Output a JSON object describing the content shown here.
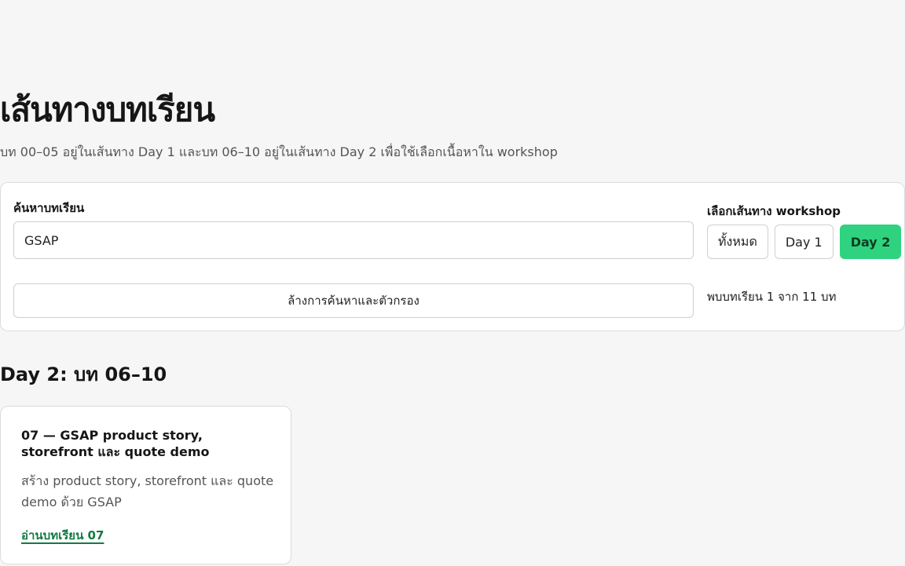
{
  "header": {
    "title": "เส้นทางบทเรียน",
    "subtitle": "บท 00–05 อยู่ในเส้นทาง Day 1 และบท 06–10 อยู่ในเส้นทาง Day 2 เพื่อใช้เลือกเนื้อหาใน workshop"
  },
  "filters": {
    "search_label": "ค้นหาบทเรียน",
    "search_value": "GSAP",
    "clear_label": "ล้างการค้นหาและตัวกรอง",
    "route_label": "เลือกเส้นทาง workshop",
    "routes": [
      {
        "label": "ทั้งหมด",
        "active": false
      },
      {
        "label": "Day 1",
        "active": false
      },
      {
        "label": "Day 2",
        "active": true
      }
    ],
    "result_count": "พบบทเรียน 1 จาก 11 บท"
  },
  "section": {
    "heading": "Day 2: บท 06–10",
    "lessons": [
      {
        "title": "07 — GSAP product story, storefront และ quote demo",
        "description": "สร้าง product story, storefront และ quote demo ด้วย GSAP",
        "link_label": "อ่านบทเรียน 07"
      }
    ]
  },
  "colors": {
    "accent": "#2fd37f",
    "link": "#137a43",
    "background": "#f6f6f6"
  }
}
